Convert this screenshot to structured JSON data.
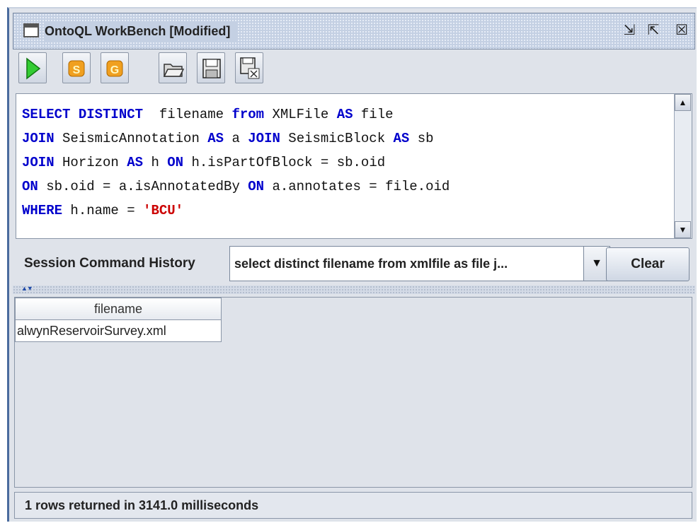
{
  "window": {
    "title": "OntoQL WorkBench [Modified]",
    "controls": [
      {
        "name": "restore-icon",
        "glyph": "⇲"
      },
      {
        "name": "maximize-icon",
        "glyph": "⇱"
      },
      {
        "name": "close-icon",
        "glyph": "☒"
      }
    ]
  },
  "toolbar": {
    "buttons": [
      {
        "name": "run-button",
        "icon": "play-icon"
      },
      {
        "name": "sparql-s-button",
        "icon": "s-icon",
        "letter": "S"
      },
      {
        "name": "sparql-g-button",
        "icon": "g-icon",
        "letter": "G"
      },
      {
        "name": "open-button",
        "icon": "folder-open-icon"
      },
      {
        "name": "save-button",
        "icon": "floppy-icon"
      },
      {
        "name": "export-button",
        "icon": "floppy-excel-icon"
      }
    ]
  },
  "editor": {
    "lines": [
      [
        {
          "t": "SELECT DISTINCT",
          "k": "kw"
        },
        {
          "t": "  filename "
        },
        {
          "t": "from",
          "k": "kw"
        },
        {
          "t": " XMLFile "
        },
        {
          "t": "AS",
          "k": "kw"
        },
        {
          "t": " file"
        }
      ],
      [
        {
          "t": "JOIN",
          "k": "kw"
        },
        {
          "t": " SeismicAnnotation "
        },
        {
          "t": "AS",
          "k": "kw"
        },
        {
          "t": " a "
        },
        {
          "t": "JOIN",
          "k": "kw"
        },
        {
          "t": " SeismicBlock "
        },
        {
          "t": "AS",
          "k": "kw"
        },
        {
          "t": " sb"
        }
      ],
      [
        {
          "t": "JOIN",
          "k": "kw"
        },
        {
          "t": " Horizon "
        },
        {
          "t": "AS",
          "k": "kw"
        },
        {
          "t": " h "
        },
        {
          "t": "ON",
          "k": "kw"
        },
        {
          "t": " h.isPartOfBlock = sb.oid"
        }
      ],
      [
        {
          "t": "ON",
          "k": "kw"
        },
        {
          "t": " sb.oid = a.isAnnotatedBy "
        },
        {
          "t": "ON",
          "k": "kw"
        },
        {
          "t": " a.annotates = file.oid"
        }
      ],
      [
        {
          "t": "WHERE",
          "k": "kw"
        },
        {
          "t": " h.name = "
        },
        {
          "t": "'BCU'",
          "k": "str"
        }
      ]
    ]
  },
  "history": {
    "label": "Session Command History",
    "selected": "select distinct filename from xmlfile as file j...",
    "clear_label": "Clear"
  },
  "results": {
    "columns": [
      "filename"
    ],
    "rows": [
      [
        "alwynReservoirSurvey.xml"
      ]
    ]
  },
  "status": {
    "text": "1 rows returned in 3141.0 milliseconds"
  }
}
